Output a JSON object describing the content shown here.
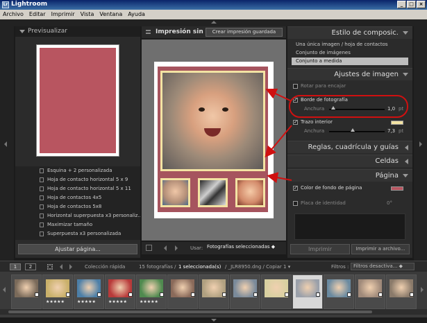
{
  "window": {
    "title": "Lightroom",
    "minimize": "_",
    "maximize": "□",
    "close": "×"
  },
  "menu": [
    "Archivo",
    "Editar",
    "Imprimir",
    "Vista",
    "Ventana",
    "Ayuda"
  ],
  "left_panel": {
    "preview_title": "Previsualizar",
    "templates": [
      "Esquina + 2 personalizada",
      "Hoja de contacto horizontal 5 x 9",
      "Hoja de contacto horizontal 5 x 11",
      "Hoja de contactos 4x5",
      "Hoja de contactos 5x8",
      "Horizontal superpuesta x3 personaliz...",
      "Maximizar tamaño",
      "Superpuesta x3 personalizada"
    ],
    "adjust_button": "Ajustar página..."
  },
  "center": {
    "title": "Impresión sin ...",
    "save_button": "Crear impresión guardada",
    "use_label": "Usar:",
    "use_value": "Fotografías seleccionadas ◆"
  },
  "right_panel": {
    "layout_style": {
      "title": "Estilo de composic.",
      "items": [
        "Una única imagen / hoja de contactos",
        "Conjunto de imágenes",
        "Conjunto a medida"
      ],
      "selected_index": 2
    },
    "image_settings": {
      "title": "Ajustes de imagen",
      "rotate_label": "Rotar para encajar",
      "rotate_checked": "",
      "photo_border_label": "Borde de fotografía",
      "photo_border_checked": "✓",
      "width_label": "Anchura",
      "photo_border_width": "1,0",
      "photo_border_unit": "pt",
      "photo_border_level": 0.08,
      "inner_stroke_label": "Trazo interior",
      "inner_stroke_checked": "✓",
      "inner_stroke_width": "7,3",
      "inner_stroke_unit": "pt",
      "inner_stroke_level": 0.43,
      "inner_stroke_color": "#f3e3a3"
    },
    "rulers_title": "Reglas, cuadrícula y guías",
    "cells_title": "Celdas",
    "page": {
      "title": "Página",
      "bg_color_label": "Color de fondo de página",
      "bg_color_checked": "✓",
      "bg_color": "#b85560",
      "identity_label": "Placa de identidad",
      "identity_value": "0°"
    },
    "print_button": "Imprimir",
    "print_file_button": "Imprimir a archivo..."
  },
  "filmstrip_bar": {
    "page1": "1",
    "page2": "2",
    "collection": "Colección rápida",
    "count_text": "15 fotografías /",
    "selected_text": "1 seleccionada(s)",
    "file_text": "/ _JLR8950.dng / Copiar 1 ▾",
    "filter_label": "Filtros :",
    "filter_value": "Filtros desactiva... ◆"
  },
  "filmstrip": {
    "selected_index": 9,
    "thumbs": [
      {
        "stars": "",
        "color": "#7a6a5a"
      },
      {
        "stars": "★★★★★",
        "color": "#c9b06a"
      },
      {
        "stars": "★★★★★",
        "color": "#4c7fa8"
      },
      {
        "stars": "★★★★★",
        "color": "#b83a3a"
      },
      {
        "stars": "★★★★★",
        "color": "#4f8a4f"
      },
      {
        "stars": "",
        "color": "#8a6a5a"
      },
      {
        "stars": "",
        "color": "#b0a080"
      },
      {
        "stars": "",
        "color": "#7a8a9a"
      },
      {
        "stars": "",
        "color": "#d8d0a0"
      },
      {
        "stars": "",
        "color": "#9aa0aa"
      },
      {
        "stars": "",
        "color": "#6a8aa0"
      },
      {
        "stars": "",
        "color": "#a08a7a"
      },
      {
        "stars": "",
        "color": "#8a7a6a"
      }
    ]
  },
  "colors": {
    "accent_red": "#d01010",
    "panel": "#2b2b2b",
    "frame_cream": "#f3e3a3"
  },
  "icons": [
    "triangle-down-icon",
    "template-icon",
    "arrow-left-icon",
    "arrow-right-icon",
    "grid-icon",
    "checkbox-icon"
  ]
}
